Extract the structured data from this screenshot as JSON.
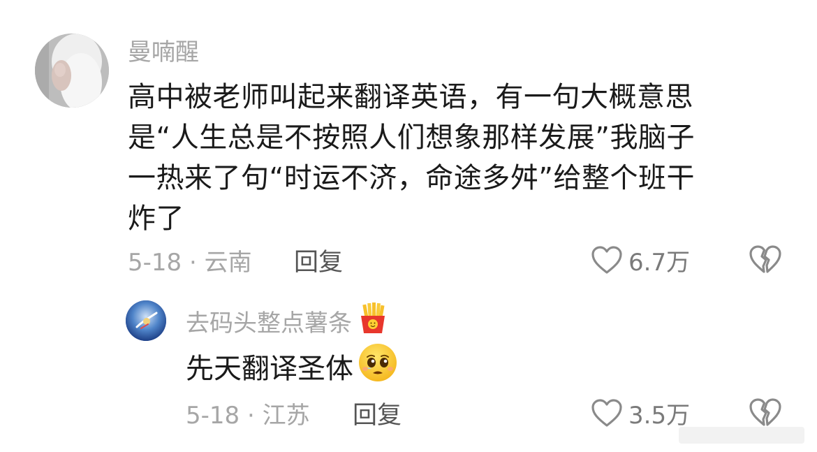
{
  "comment": {
    "username": "曼喃醒",
    "content": "高中被老师叫起来翻译英语，有一句大概意思\n是“人生总是不按照人们想象那样发展”我脑子\n一热来了句“时运不济，命途多舛”给整个班干\n炸了",
    "meta": "5-18 · 云南",
    "reply_label": "回复",
    "like_count": "6.7万",
    "icons": {
      "like": "heart-outline-icon",
      "dislike": "broken-heart-icon"
    }
  },
  "reply": {
    "username": "去码头整点薯条",
    "username_badge": "french-fries-emoji-icon",
    "content": "先天翻译圣体",
    "content_emoji": "pleading-face-emoji-icon",
    "meta": "5-18 · 江苏",
    "reply_label": "回复",
    "like_count": "3.5万",
    "icons": {
      "like": "heart-outline-icon",
      "dislike": "broken-heart-icon"
    }
  },
  "colors": {
    "username": "#a6a6a6",
    "text": "#1a1a1a",
    "meta": "#a6a6a6",
    "reply": "#555555",
    "icon": "#8a8a8a"
  }
}
